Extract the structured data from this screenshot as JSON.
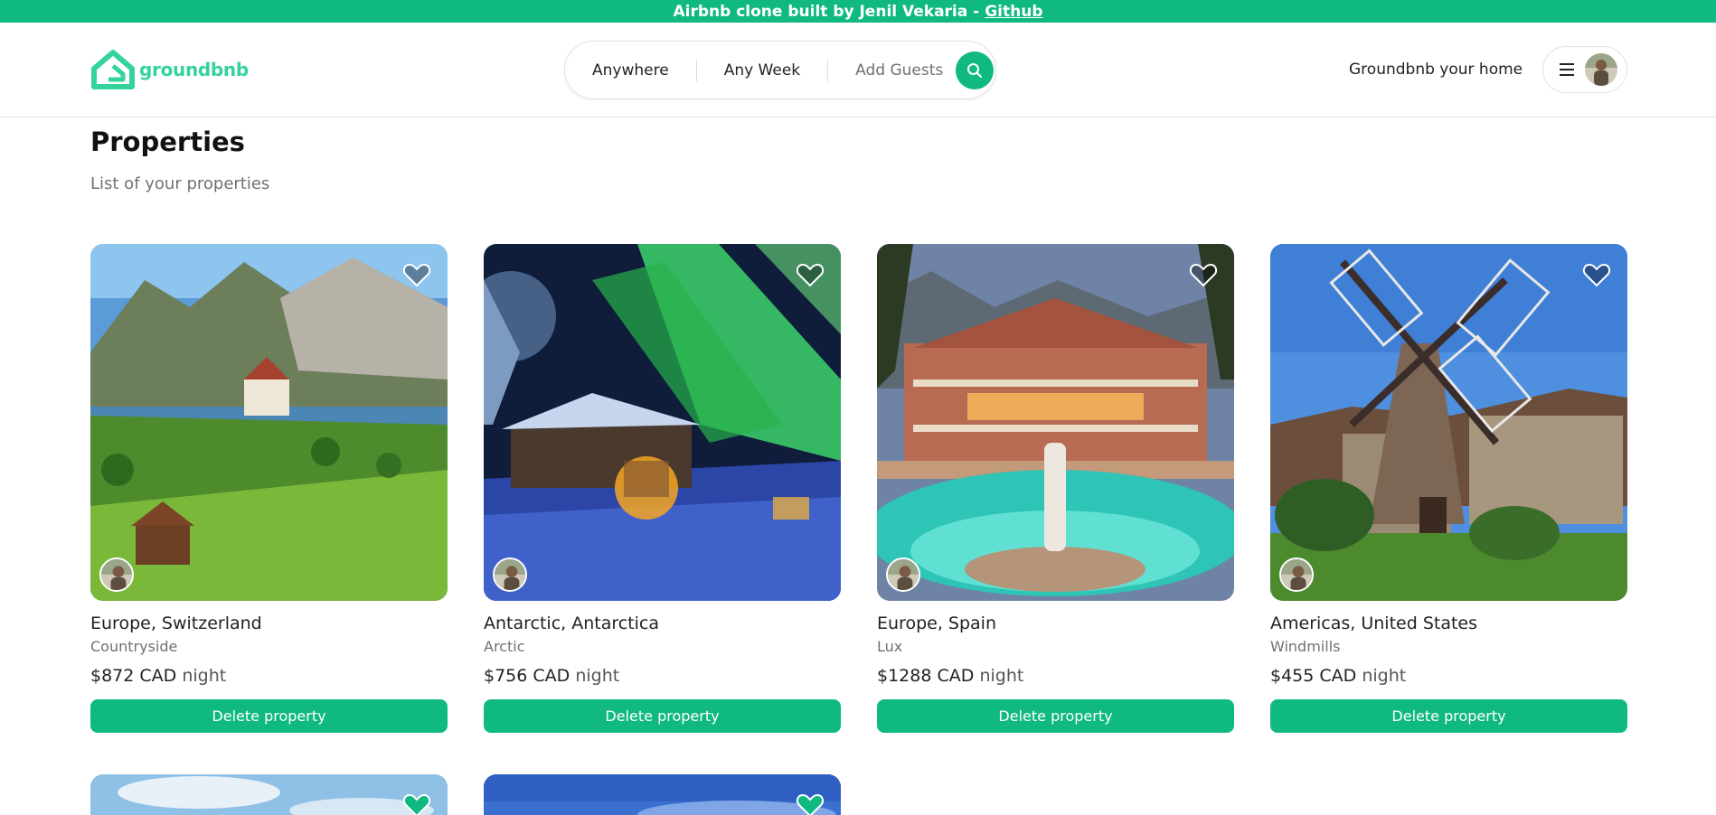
{
  "banner": {
    "text": "Airbnb clone built by Jenil Vekaria -",
    "link": "Github"
  },
  "header": {
    "logo_text": "groundbnb",
    "search": {
      "where": "Anywhere",
      "when": "Any Week",
      "guests": "Add Guests"
    },
    "host_link": "Groundbnb your home"
  },
  "page": {
    "title": "Properties",
    "subtitle": "List of your properties"
  },
  "properties": [
    {
      "location": "Europe, Switzerland",
      "category": "Countryside",
      "price": "$872 CAD",
      "unit": "night",
      "delete_label": "Delete property",
      "favorited": false
    },
    {
      "location": "Antarctic, Antarctica",
      "category": "Arctic",
      "price": "$756 CAD",
      "unit": "night",
      "delete_label": "Delete property",
      "favorited": false
    },
    {
      "location": "Europe, Spain",
      "category": "Lux",
      "price": "$1288 CAD",
      "unit": "night",
      "delete_label": "Delete property",
      "favorited": false
    },
    {
      "location": "Americas, United States",
      "category": "Windmills",
      "price": "$455 CAD",
      "unit": "night",
      "delete_label": "Delete property",
      "favorited": false
    }
  ],
  "partial_cards": [
    {
      "favorited": true
    },
    {
      "favorited": true
    }
  ],
  "colors": {
    "brand": "#10b981",
    "logo": "#34d399",
    "muted": "#717171"
  }
}
